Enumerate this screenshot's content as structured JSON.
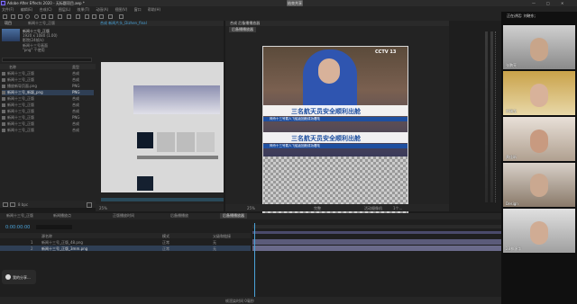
{
  "window": {
    "title": "Adobe After Effects 2020 - 无标题项目.aep *",
    "share_label": "结束共享"
  },
  "menu": [
    "文件(F)",
    "编辑(E)",
    "合成(C)",
    "图层(L)",
    "效果(T)",
    "动画(A)",
    "视图(V)",
    "窗口",
    "帮助(H)"
  ],
  "project": {
    "panel_title": "项目",
    "comp_title": "新闻十三号_正版",
    "thumb_line1": "新闻十三号_正版",
    "thumb_line2": "1920 x 1080 (1.00)",
    "thumb_line3": "影院(24帧/s)",
    "footage_line1": "新闻十三号画面",
    "footage_line2": "\"png\" 个使用",
    "col_name": "名称",
    "col_type": "类型",
    "rows": [
      {
        "name": "新闻十三号_正版",
        "type": "合成"
      },
      {
        "name": "新闻十三号_正版",
        "type": "合成"
      },
      {
        "name": "播放新导页面.png",
        "type": "PNG"
      },
      {
        "name": "新闻十三号_新颖_png",
        "type": "PNG"
      },
      {
        "name": "新闻十三号_正版",
        "type": "合成"
      },
      {
        "name": "新闻十三号_正版",
        "type": "合成"
      },
      {
        "name": "新闻十三号_正版",
        "type": "合成"
      },
      {
        "name": "新闻十三号_正版",
        "type": "PNG"
      },
      {
        "name": "新闻十三号_正版",
        "type": "合成"
      },
      {
        "name": "新闻十三号_正版",
        "type": "合成"
      }
    ],
    "footer_bpc": "8 bpc"
  },
  "comp_left": {
    "tab": "合成 新闻片头_Dizhen_final",
    "zoom": "25%"
  },
  "comp_center": {
    "tab": "合成 后备播播放器",
    "subtab": "后备播播放器",
    "logo": "CCTV 13",
    "headline1": "三名航天员安全顺利出舱",
    "headline2": "三名航天员安全顺利出舱",
    "ticker1": "神舟十三号载人飞船返回舱成功着陆",
    "ticker2": "神舟十三号载人飞船返回舱成功着陆",
    "zoom": "25%",
    "quality": "完整",
    "camera": "活动摄像机",
    "views": "1个..."
  },
  "timeline": {
    "tabs": [
      "新闻十三号_正版",
      "新闻播放点",
      "正版播放时间",
      "后备播播放",
      "后备播播放器"
    ],
    "timecode": "0:00:00:00",
    "col_source": "源名称",
    "col_mode": "模式",
    "col_parent": "父级和链接",
    "layers": [
      {
        "num": "1",
        "name": "新闻十三号_正版_48.png",
        "mode": "正常",
        "parent": "无"
      },
      {
        "num": "2",
        "name": "新闻十三号_正版_3mm.png",
        "mode": "正常",
        "parent": "无"
      }
    ],
    "render_time": "帧渲染时间 0毫秒"
  },
  "screen_share_label": "我的分享...",
  "video_call": {
    "header": "正在讲话: 刘晓东;",
    "participants": [
      {
        "name": "张鹏亮"
      },
      {
        "name": "刘瑞龙"
      },
      {
        "name": "黄佳昕"
      },
      {
        "name": "Design"
      },
      {
        "name": "28林源华"
      }
    ]
  },
  "colors": {
    "accent": "#3a86c8",
    "timeline_bar": "#5b5b7a",
    "cctv_blue": "#1e4fa0"
  }
}
